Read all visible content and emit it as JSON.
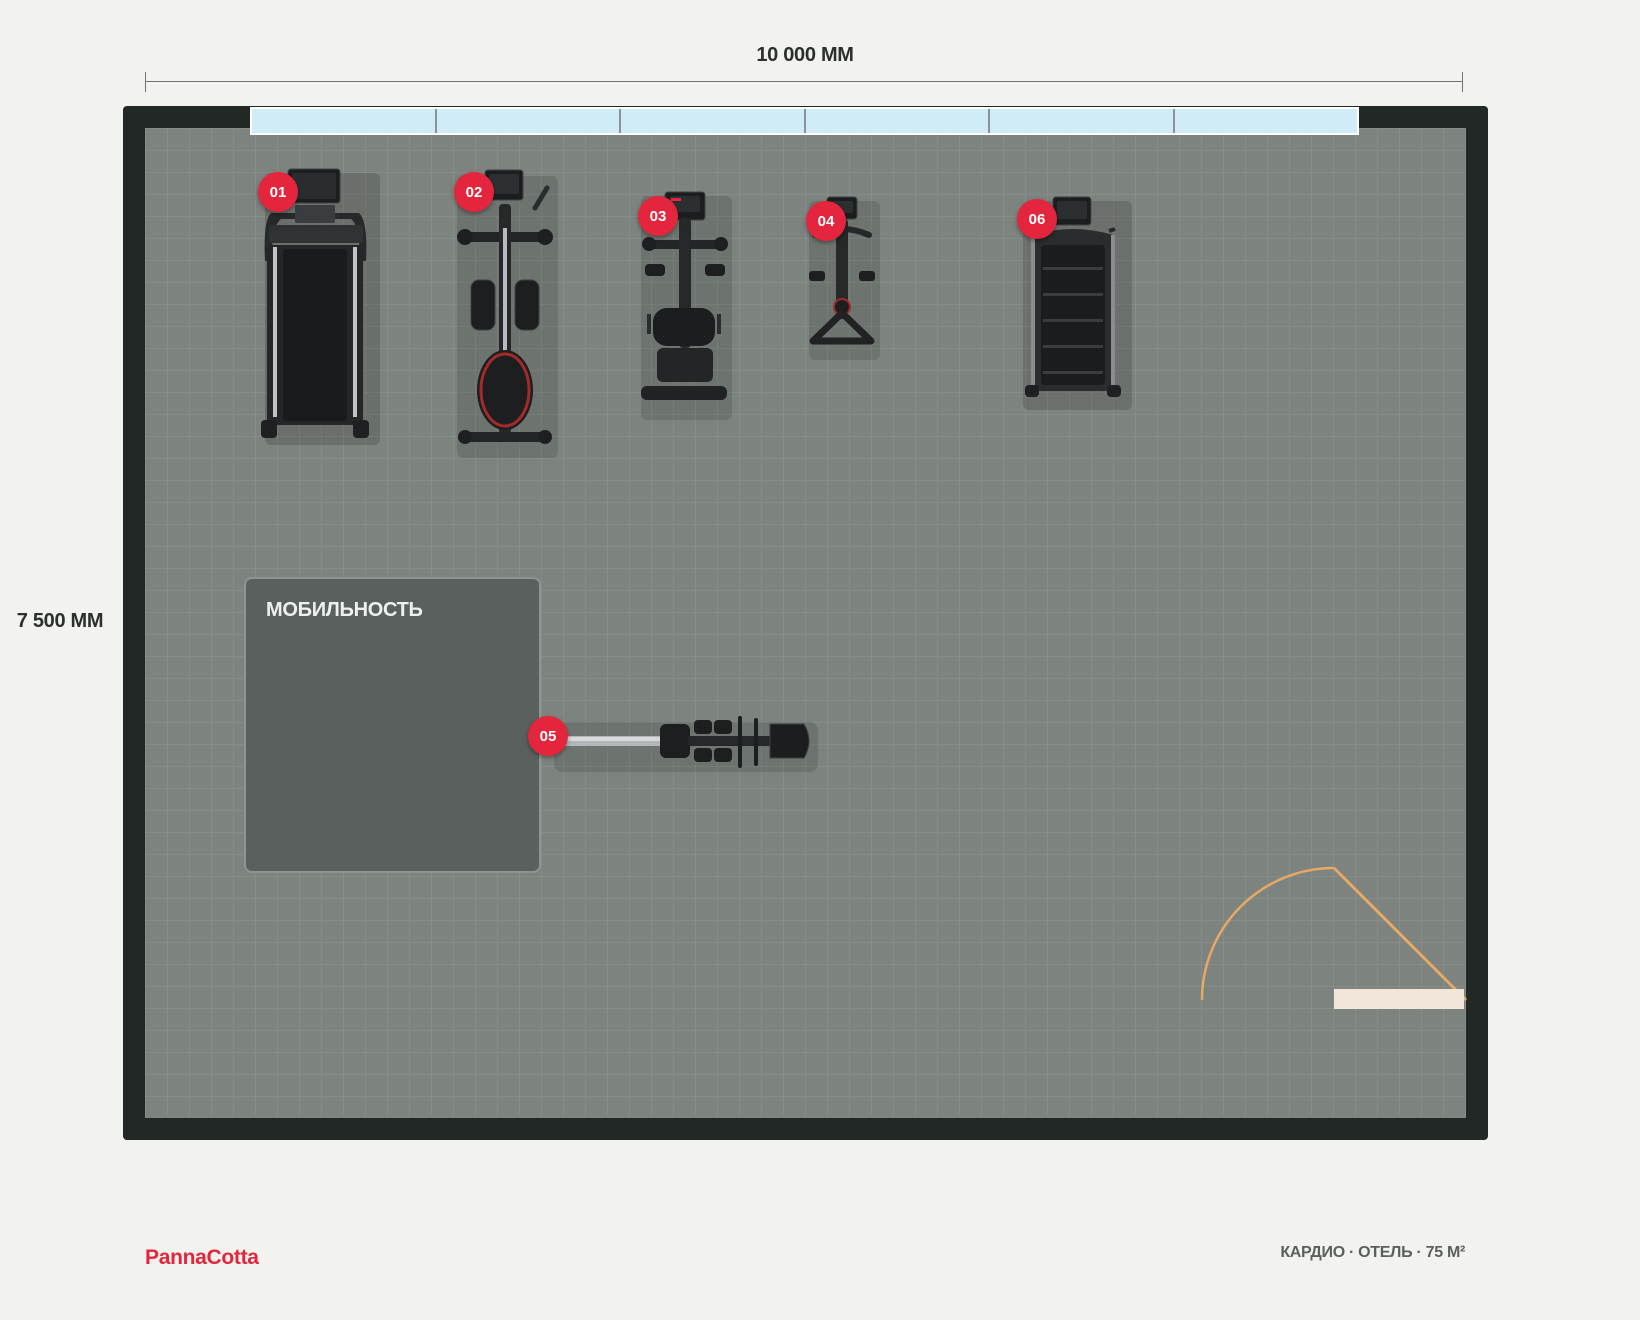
{
  "dimensions": {
    "width_label": "10 000 ММ",
    "height_label": "7 500 ММ"
  },
  "zone": {
    "label": "МОБИЛЬНОСТЬ"
  },
  "equipment": [
    {
      "id": "01",
      "icon": "treadmill-icon"
    },
    {
      "id": "02",
      "icon": "elliptical-icon"
    },
    {
      "id": "03",
      "icon": "recumbent-bike-icon"
    },
    {
      "id": "04",
      "icon": "upright-bike-icon"
    },
    {
      "id": "05",
      "icon": "rowing-machine-icon"
    },
    {
      "id": "06",
      "icon": "stair-climber-icon"
    }
  ],
  "footer": {
    "brand": "PannaCotta",
    "caption": "КАРДИО · ОТЕЛЬ · 75 М²"
  },
  "colors": {
    "accent": "#e3263d",
    "wall": "#222826",
    "floor": "#7d837e",
    "window": "#d0ecf7",
    "door_arc": "#e8a866"
  }
}
